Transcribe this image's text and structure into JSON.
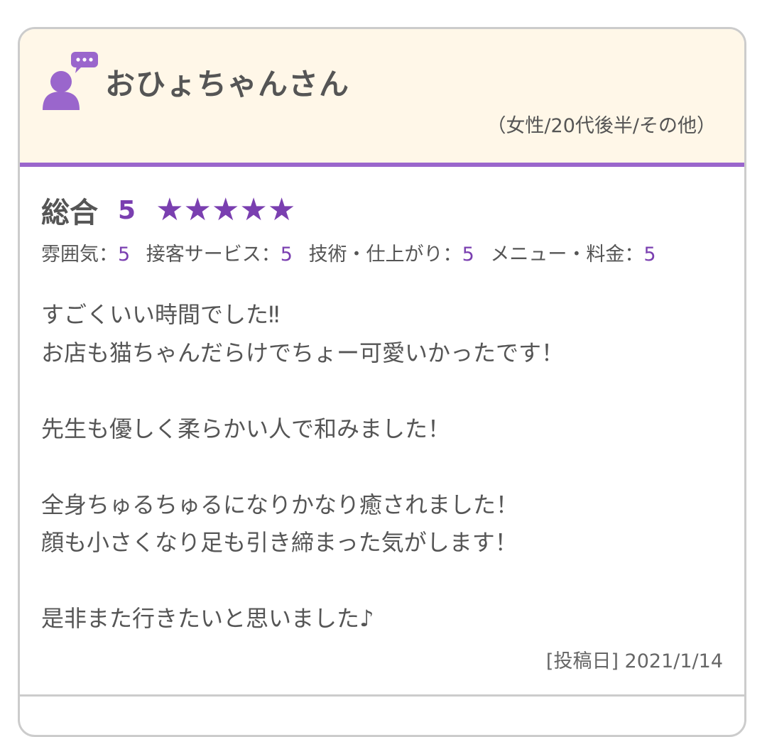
{
  "reviewer": {
    "name": "おひょちゃんさん",
    "meta": "（女性/20代後半/その他）"
  },
  "rating": {
    "overall_label": "総合",
    "overall_score": "5",
    "stars_filled": 5,
    "stars_total": 5,
    "star_glyph": "★",
    "accent_color": "#7a3fb0",
    "categories": [
      {
        "label": "雰囲気：",
        "value": "5"
      },
      {
        "label": "接客サービス：",
        "value": "5"
      },
      {
        "label": "技術・仕上がり：",
        "value": "5"
      },
      {
        "label": "メニュー・料金：",
        "value": "5"
      }
    ]
  },
  "comment": {
    "lines": [
      "すごくいい時間でした‼",
      "お店も猫ちゃんだらけでちょー可愛いかったです！",
      "",
      "先生も優しく柔らかい人で和みました！",
      "",
      "全身ちゅるちゅるになりかなり癒されました！",
      "顔も小さくなり足も引き締まった気がします！",
      "",
      "是非また行きたいと思いました♪"
    ]
  },
  "post_date": "[投稿日] 2021/1/14",
  "icons": {
    "avatar": "user-comment-icon"
  }
}
